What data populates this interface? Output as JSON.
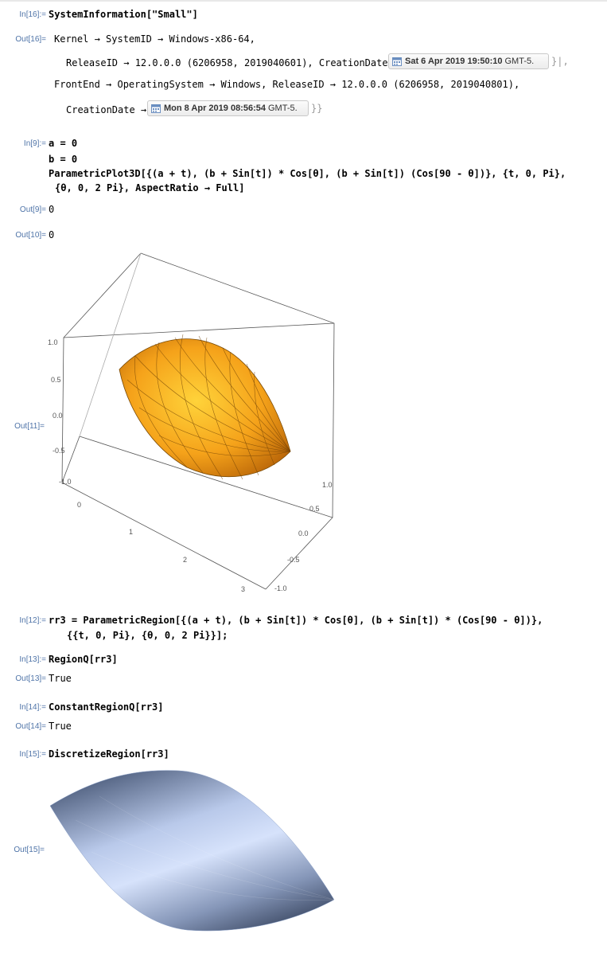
{
  "cells": {
    "in16_label": "In[16]:=",
    "in16_code": "SystemInformation[\"Small\"]",
    "out16_label": "Out[16]=",
    "out16_line1": "Kernel → SystemID → Windows-x86-64,",
    "out16_line2": "ReleaseID → 12.0.0.0 (6206958, 2019040601), CreationDate →",
    "out16_date1": "Sat 6 Apr 2019 19:50:10",
    "out16_tz1": "GMT-5.",
    "out16_line3": "FrontEnd → OperatingSystem → Windows, ReleaseID → 12.0.0.0 (6206958, 2019040801),",
    "out16_line4": "CreationDate →",
    "out16_date2": "Mon 8 Apr 2019 08:56:54",
    "out16_tz2": "GMT-5.",
    "in9_label": "In[9]:=",
    "in9_line1": "a = 0",
    "in9_line2": "b = 0",
    "in9_line3": "ParametricPlot3D[{(a + t), (b + Sin[t]) * Cos[θ], (b + Sin[t]) (Cos[90 - θ])}, {t, 0, Pi},",
    "in9_line4": "{θ, 0, 2 Pi}, AspectRatio → Full]",
    "out9_label": "Out[9]=",
    "out9_value": "0",
    "out10_label": "Out[10]=",
    "out10_value": "0",
    "out11_label": "Out[11]=",
    "in12_label": "In[12]:=",
    "in12_line1": "rr3 = ParametricRegion[{(a + t), (b + Sin[t]) * Cos[θ], (b + Sin[t]) * (Cos[90 - θ])},",
    "in12_line2": "{{t, 0, Pi}, {θ, 0, 2 Pi}}];",
    "in13_label": "In[13]:=",
    "in13_code": "RegionQ[rr3]",
    "out13_label": "Out[13]=",
    "out13_value": "True",
    "in14_label": "In[14]:=",
    "in14_code": "ConstantRegionQ[rr3]",
    "out14_label": "Out[14]=",
    "out14_value": "True",
    "in15_label": "In[15]:=",
    "in15_code": "DiscretizeRegion[rr3]",
    "out15_label": "Out[15]="
  },
  "plot3d": {
    "z_ticks": [
      "1.0",
      "0.5",
      "0.0",
      "-0.5",
      "-1.0"
    ],
    "x_ticks": [
      "0",
      "1",
      "2",
      "3"
    ],
    "y_ticks": [
      "1.0",
      "0.5",
      "0.0",
      "-0.5",
      "-1.0"
    ],
    "surface_color": "#f5a21a",
    "region_color": "#a9bde0"
  }
}
